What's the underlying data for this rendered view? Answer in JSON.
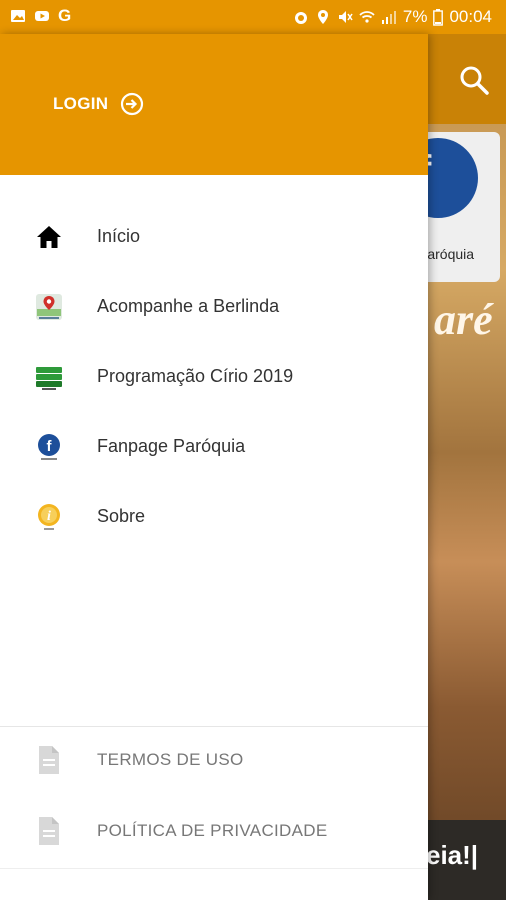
{
  "status_bar": {
    "left_icons": [
      "gallery-icon",
      "youtube-icon",
      "google-icon"
    ],
    "battery": "7%",
    "time": "00:04"
  },
  "drawer": {
    "login_label": "LOGIN",
    "items": [
      {
        "label": "Início",
        "icon": "home-icon"
      },
      {
        "label": "Acompanhe a Berlinda",
        "icon": "map-pin-icon"
      },
      {
        "label": "Programação Círio 2019",
        "icon": "schedule-icon"
      },
      {
        "label": "Fanpage Paróquia",
        "icon": "facebook-icon"
      },
      {
        "label": "Sobre",
        "icon": "info-icon"
      }
    ],
    "footer": [
      {
        "label": "TERMOS DE USO",
        "icon": "document-icon"
      },
      {
        "label": "POLÍTICA DE PRIVACIDADE",
        "icon": "document-icon"
      }
    ]
  },
  "background_app": {
    "fb_label": "Paróquia",
    "title_fragment": "aré",
    "bottom_text": "eia!|"
  },
  "colors": {
    "accent": "#e69500",
    "text": "#333333",
    "muted": "#777777"
  }
}
